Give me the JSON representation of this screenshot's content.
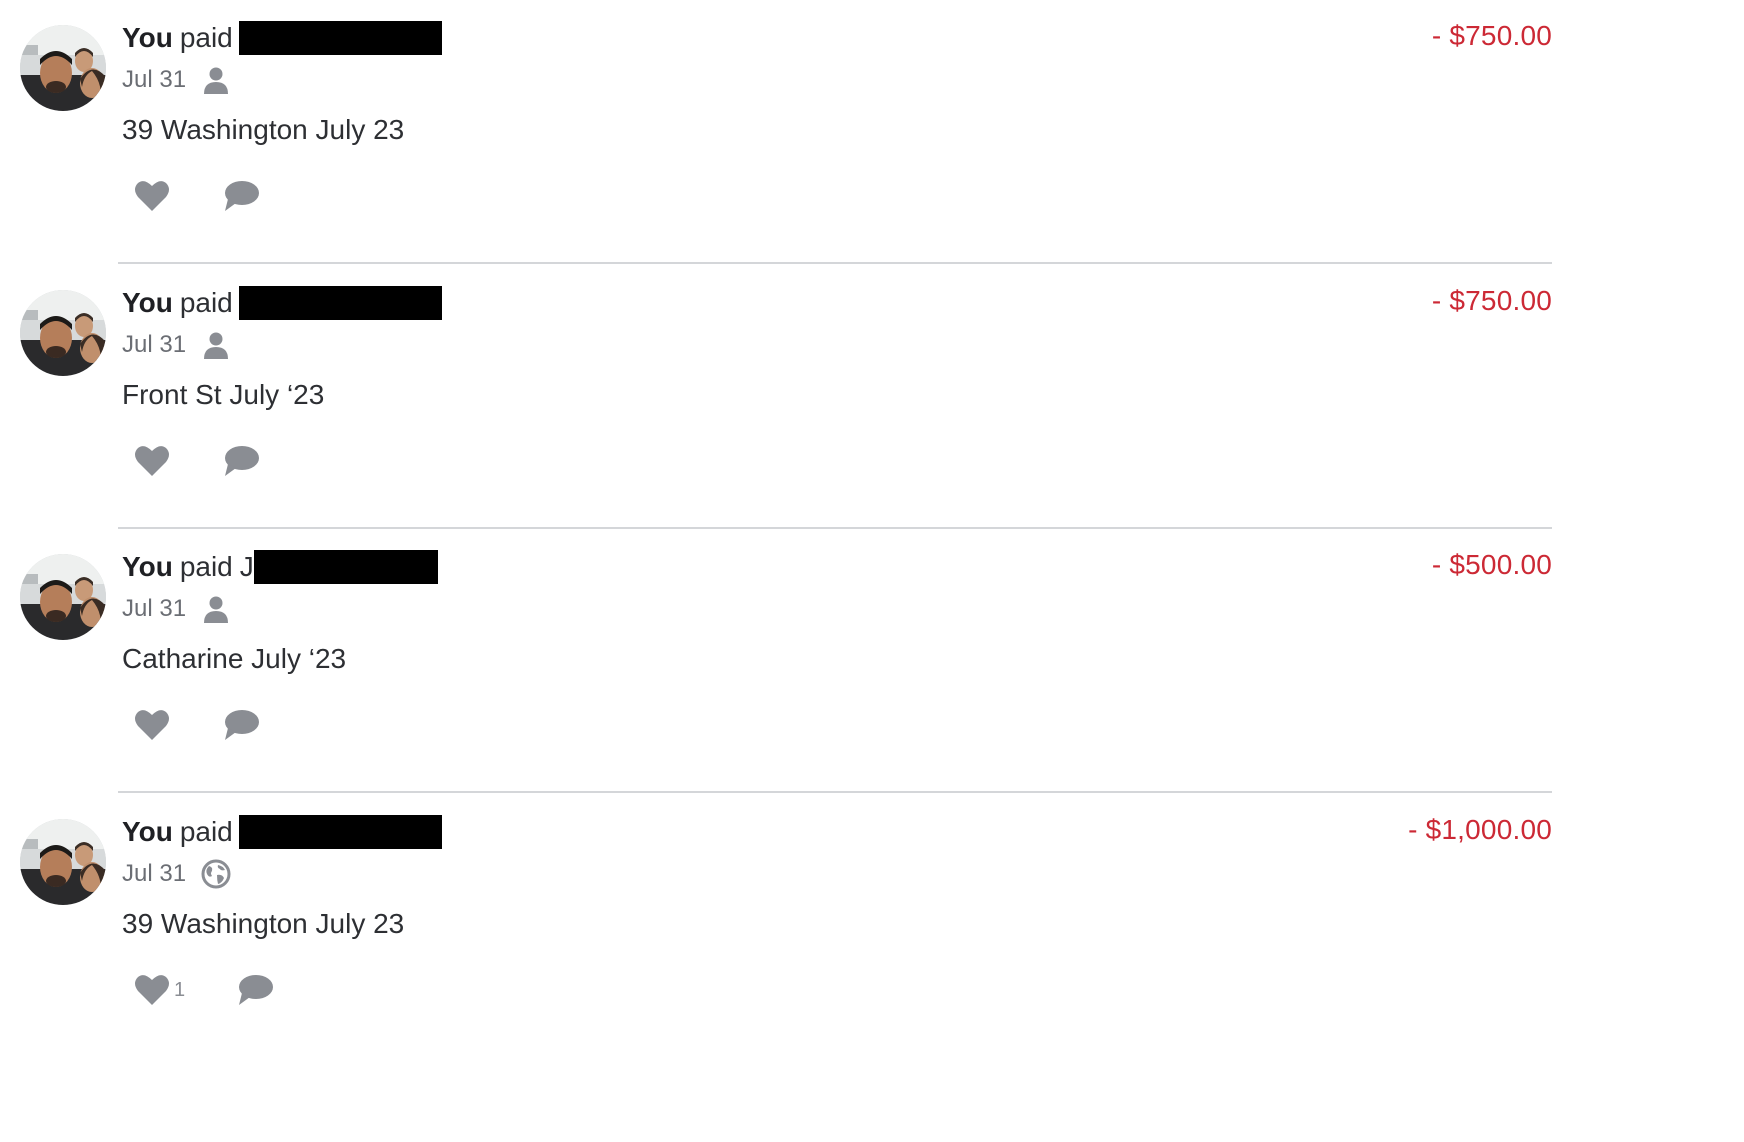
{
  "feed": {
    "transactions": [
      {
        "actor": "You",
        "verb": "paid",
        "recipient_prefix": "",
        "amount": "- $750.00",
        "date": "Jul 31",
        "audience_icon": "person-icon",
        "note": "39 Washington July 23",
        "likes": null
      },
      {
        "actor": "You",
        "verb": "paid",
        "recipient_prefix": "",
        "amount": "- $750.00",
        "date": "Jul 31",
        "audience_icon": "person-icon",
        "note": "Front St July ‘23",
        "likes": null
      },
      {
        "actor": "You",
        "verb": "paid",
        "recipient_prefix": "J",
        "amount": "- $500.00",
        "date": "Jul 31",
        "audience_icon": "person-icon",
        "note": "Catharine July ‘23",
        "likes": null
      },
      {
        "actor": "You",
        "verb": "paid",
        "recipient_prefix": "",
        "amount": "- $1,000.00",
        "date": "Jul 31",
        "audience_icon": "globe-icon",
        "note": "39 Washington July 23",
        "likes": "1"
      }
    ]
  },
  "colors": {
    "amount_negative": "#cc2935",
    "icon_gray": "#8a8d93",
    "divider": "#d4d6d9",
    "redaction": "#000000"
  }
}
